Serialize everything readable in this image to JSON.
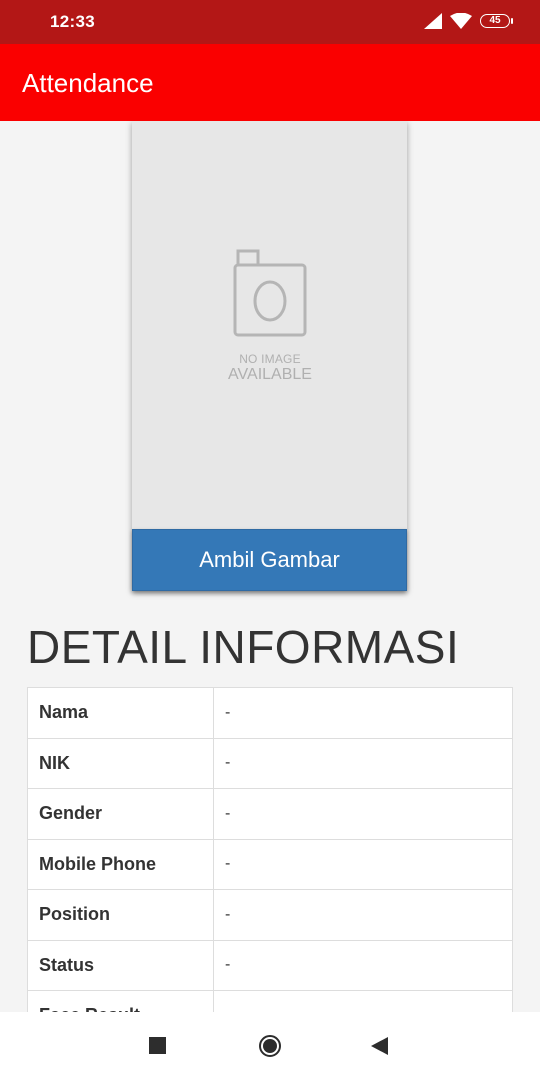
{
  "status_bar": {
    "time": "12:33",
    "battery": "45",
    "icons": [
      "signal-icon",
      "wifi-icon",
      "battery-icon"
    ]
  },
  "app_bar": {
    "title": "Attendance"
  },
  "photo": {
    "placeholder_line1": "NO IMAGE",
    "placeholder_line2": "AVAILABLE",
    "icon": "camera-icon"
  },
  "capture_button": {
    "label": "Ambil Gambar"
  },
  "detail": {
    "title": "DETAIL INFORMASI",
    "rows": [
      {
        "label": "Nama",
        "value": "-"
      },
      {
        "label": "NIK",
        "value": "-"
      },
      {
        "label": "Gender",
        "value": "-"
      },
      {
        "label": "Mobile Phone",
        "value": "-"
      },
      {
        "label": "Position",
        "value": "-"
      },
      {
        "label": "Status",
        "value": "-"
      },
      {
        "label": "Face Result",
        "value": "-"
      }
    ]
  },
  "nav_bar": {
    "icons": [
      "recent-apps-icon",
      "home-icon",
      "back-icon"
    ]
  },
  "colors": {
    "status_bar": "#b31716",
    "app_bar": "#fa0000",
    "button": "#3478b7",
    "background": "#f4f4f4"
  }
}
